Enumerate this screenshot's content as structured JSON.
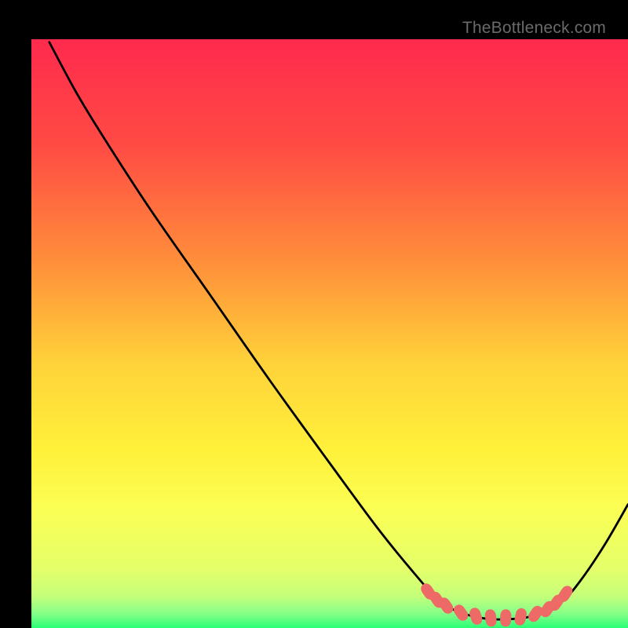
{
  "watermark": "TheBottleneck.com",
  "chart_data": {
    "type": "line",
    "title": "",
    "xlabel": "",
    "ylabel": "",
    "xlim": [
      0,
      100
    ],
    "ylim": [
      0,
      100
    ],
    "background_gradient": {
      "stops": [
        {
          "offset": 0.0,
          "color": "#ff2a4d"
        },
        {
          "offset": 0.18,
          "color": "#ff4b44"
        },
        {
          "offset": 0.38,
          "color": "#ff8f3a"
        },
        {
          "offset": 0.55,
          "color": "#ffd23a"
        },
        {
          "offset": 0.7,
          "color": "#fff13a"
        },
        {
          "offset": 0.8,
          "color": "#fbff55"
        },
        {
          "offset": 0.9,
          "color": "#e4ff6a"
        },
        {
          "offset": 0.945,
          "color": "#c6ff7a"
        },
        {
          "offset": 0.975,
          "color": "#87ff88"
        },
        {
          "offset": 1.0,
          "color": "#2bff77"
        }
      ]
    },
    "series": [
      {
        "name": "bottleneck-curve",
        "type": "line",
        "color": "#000000",
        "points": [
          {
            "x": 3.0,
            "y": 99.5
          },
          {
            "x": 7.5,
            "y": 91.0
          },
          {
            "x": 12.0,
            "y": 83.5
          },
          {
            "x": 20.0,
            "y": 71.0
          },
          {
            "x": 30.0,
            "y": 56.5
          },
          {
            "x": 40.0,
            "y": 42.0
          },
          {
            "x": 50.0,
            "y": 28.0
          },
          {
            "x": 58.0,
            "y": 17.0
          },
          {
            "x": 64.0,
            "y": 9.5
          },
          {
            "x": 68.0,
            "y": 5.0
          },
          {
            "x": 71.0,
            "y": 3.0
          },
          {
            "x": 74.0,
            "y": 2.0
          },
          {
            "x": 77.0,
            "y": 1.5
          },
          {
            "x": 80.0,
            "y": 1.5
          },
          {
            "x": 83.0,
            "y": 1.8
          },
          {
            "x": 86.0,
            "y": 2.7
          },
          {
            "x": 89.0,
            "y": 4.5
          },
          {
            "x": 92.0,
            "y": 8.0
          },
          {
            "x": 96.0,
            "y": 14.0
          },
          {
            "x": 100.0,
            "y": 21.0
          }
        ]
      },
      {
        "name": "optimal-zone-markers",
        "type": "scatter",
        "color": "#ed6a66",
        "points": [
          {
            "x": 66.5,
            "y": 6.2
          },
          {
            "x": 68.0,
            "y": 4.8
          },
          {
            "x": 69.5,
            "y": 3.8
          },
          {
            "x": 72.0,
            "y": 2.6
          },
          {
            "x": 74.5,
            "y": 2.0
          },
          {
            "x": 77.0,
            "y": 1.7
          },
          {
            "x": 79.5,
            "y": 1.7
          },
          {
            "x": 82.0,
            "y": 1.9
          },
          {
            "x": 84.5,
            "y": 2.4
          },
          {
            "x": 86.5,
            "y": 3.2
          },
          {
            "x": 88.0,
            "y": 4.3
          },
          {
            "x": 89.5,
            "y": 5.8
          }
        ]
      }
    ]
  }
}
